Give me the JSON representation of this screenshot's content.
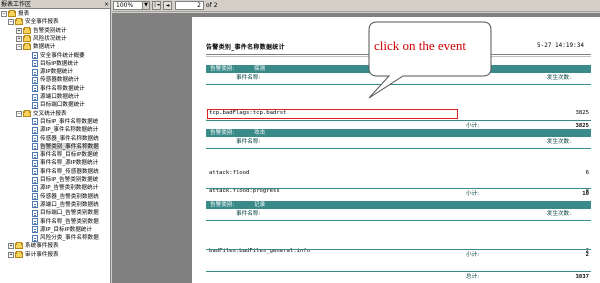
{
  "panel": {
    "title": "报表工作区",
    "close": "×",
    "tree": [
      {
        "label": "报表",
        "kind": "folder",
        "exp": "−",
        "level": 0
      },
      {
        "label": "安全事件报表",
        "kind": "folder",
        "exp": "−",
        "level": 1
      },
      {
        "label": "告警类别统计",
        "kind": "folder",
        "exp": "+",
        "level": 2
      },
      {
        "label": "风险状况统计",
        "kind": "folder",
        "exp": "+",
        "level": 2
      },
      {
        "label": "数据统计",
        "kind": "folder",
        "exp": "−",
        "level": 2
      },
      {
        "label": "安全事件统计概要",
        "kind": "doc",
        "level": 3
      },
      {
        "label": "目标IP数据统计",
        "kind": "doc",
        "level": 3
      },
      {
        "label": "源IP数据统计",
        "kind": "doc",
        "level": 3
      },
      {
        "label": "传感器数据统计",
        "kind": "doc",
        "level": 3
      },
      {
        "label": "事件名称数据统计",
        "kind": "doc",
        "level": 3
      },
      {
        "label": "源端口数据统计",
        "kind": "doc",
        "level": 3
      },
      {
        "label": "目标端口数据统计",
        "kind": "doc",
        "level": 3
      },
      {
        "label": "交叉统计报表",
        "kind": "folder",
        "exp": "−",
        "level": 2
      },
      {
        "label": "目标IP_事件名称数据统",
        "kind": "doc",
        "level": 3
      },
      {
        "label": "源IP_事件名称数据统计",
        "kind": "doc",
        "level": 3
      },
      {
        "label": "传感器_事件名称数据统",
        "kind": "doc",
        "level": 3
      },
      {
        "label": "告警类别_事件名称数据",
        "kind": "doc",
        "level": 3,
        "selected": true
      },
      {
        "label": "事件名称_目标IP数据统",
        "kind": "doc",
        "level": 3
      },
      {
        "label": "事件名称_源IP数据统计",
        "kind": "doc",
        "level": 3
      },
      {
        "label": "事件名称_传感器数据统",
        "kind": "doc",
        "level": 3
      },
      {
        "label": "目标IP_告警类别数据统",
        "kind": "doc",
        "level": 3
      },
      {
        "label": "源IP_告警类别数据统计",
        "kind": "doc",
        "level": 3
      },
      {
        "label": "传感器_告警类别数据统",
        "kind": "doc",
        "level": 3
      },
      {
        "label": "源端口_告警类别数据统",
        "kind": "doc",
        "level": 3
      },
      {
        "label": "目标端口_告警类别数据",
        "kind": "doc",
        "level": 3
      },
      {
        "label": "事件名称_告警类别数据",
        "kind": "doc",
        "level": 3
      },
      {
        "label": "源IP_目标IP数据统计",
        "kind": "doc",
        "level": 3
      },
      {
        "label": "风险分类_事件名称数据",
        "kind": "doc",
        "level": 3
      },
      {
        "label": "系统事件报表",
        "kind": "folder",
        "exp": "+",
        "level": 1
      },
      {
        "label": "审计事件报表",
        "kind": "folder",
        "exp": "+",
        "level": 1
      }
    ]
  },
  "toolbar": {
    "zoom": "100%",
    "zoom_arrow": "▼",
    "first": "|◄",
    "prev": "◄",
    "page": "2",
    "of": "of 2"
  },
  "report": {
    "title": "告警类别_事件名称数据统计",
    "date": "5-27   14:19:34",
    "groups": [
      {
        "cat_label": "告警类别:",
        "cat_value": "探测",
        "col_name": "事件名称:",
        "col_count": "发生次数:",
        "rows": [
          {
            "name": "tcp.badFlags:tcp.badrst",
            "count": "3825"
          }
        ],
        "subtotal_label": "小计:",
        "subtotal": "3825"
      },
      {
        "cat_label": "告警类别:",
        "cat_value": "攻击",
        "col_name": "事件名称:",
        "col_count": "发生次数:",
        "rows": [
          {
            "name": "attack:flood",
            "count": "6"
          },
          {
            "name": "attack.flood:progress",
            "count": "4"
          }
        ],
        "subtotal_label": "小计:",
        "subtotal": "10"
      },
      {
        "cat_label": "告警类别:",
        "cat_value": "记录",
        "col_name": "事件名称:",
        "col_count": "发生次数:",
        "rows": [
          {
            "name": "badFiles:badFiles_general:info",
            "count": "2"
          }
        ],
        "subtotal_label": "小计:",
        "subtotal": "2"
      }
    ],
    "total_label": "总计:",
    "total": "3837"
  },
  "annotation": {
    "text": "click on the event",
    "color": "#d00000"
  },
  "colors": {
    "band": "#3a8a8a",
    "highlight": "#e02020"
  }
}
